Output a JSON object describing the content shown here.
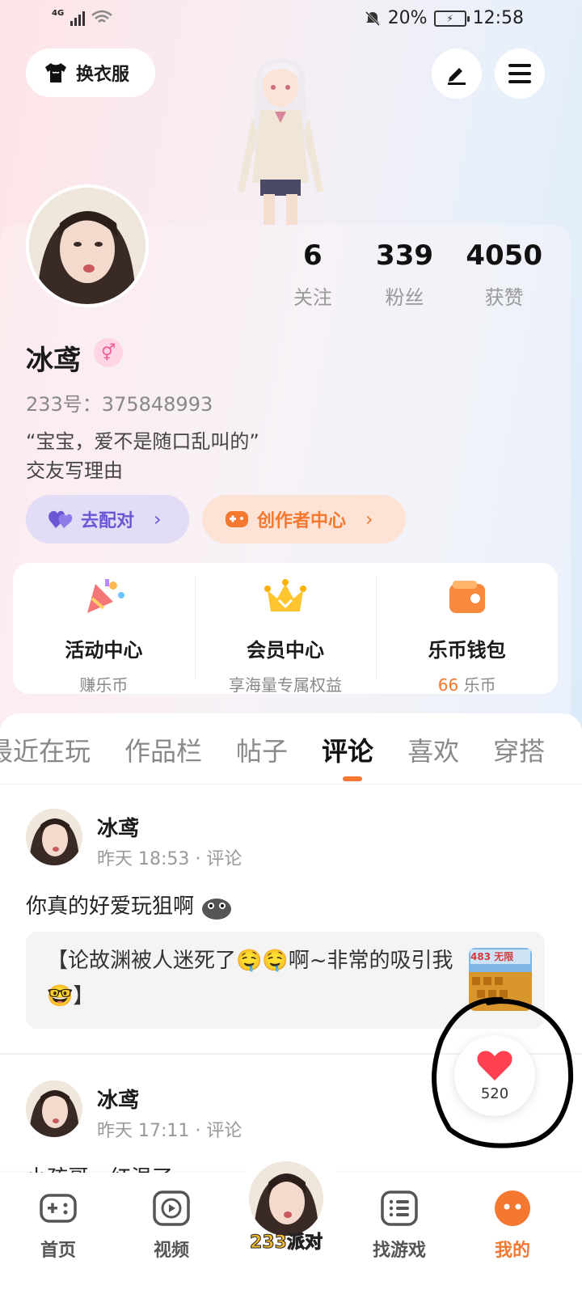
{
  "status_bar": {
    "network": "4G",
    "battery": "20%",
    "time": "12:58"
  },
  "header": {
    "outfit_label": "换衣服"
  },
  "profile": {
    "nickname": "冰鸢",
    "gender_icon": "female",
    "uid": "233号：375848993",
    "bio_line1": "“宝宝，爱不是随口乱叫的”",
    "bio_line2": "交友写理由",
    "stats": [
      {
        "value": "6",
        "label": "关注"
      },
      {
        "value": "339",
        "label": "粉丝"
      },
      {
        "value": "4050",
        "label": "获赞"
      }
    ],
    "match_label": "去配对",
    "creator_label": "创作者中心"
  },
  "features": [
    {
      "title": "活动中心",
      "sub": "赚乐币",
      "icon": "party-popper-icon"
    },
    {
      "title": "会员中心",
      "sub": "享海量专属权益",
      "icon": "crown-icon"
    },
    {
      "title": "乐币钱包",
      "sub_num": "66",
      "sub_unit": " 乐币",
      "icon": "wallet-icon"
    }
  ],
  "tabs": [
    "最近在玩",
    "作品栏",
    "帖子",
    "评论",
    "喜欢",
    "穿搭"
  ],
  "active_tab": "评论",
  "comments": [
    {
      "author": "冰鸢",
      "meta": "昨天 18:53 · 评论",
      "text": "你真的好爱玩狙啊",
      "quote_text": "【论故渊被人迷死了🤤🤤啊~非常的吸引我🤓】",
      "thumb_text": "483 无限"
    },
    {
      "author": "冰鸢",
      "meta": "昨天 17:11 · 评论",
      "text": "小孩哥，红温了"
    }
  ],
  "like": {
    "count": "520"
  },
  "bottom_nav": [
    {
      "label": "首页",
      "icon": "gamepad-icon"
    },
    {
      "label": "视频",
      "icon": "video-play-icon"
    },
    {
      "label": "233派对",
      "icon": "party-avatar"
    },
    {
      "label": "找游戏",
      "icon": "list-icon"
    },
    {
      "label": "我的",
      "icon": "profile-smile-icon"
    }
  ],
  "colors": {
    "accent": "#f4782f",
    "match": "#6c56d6",
    "gender": "#ee5a94"
  }
}
